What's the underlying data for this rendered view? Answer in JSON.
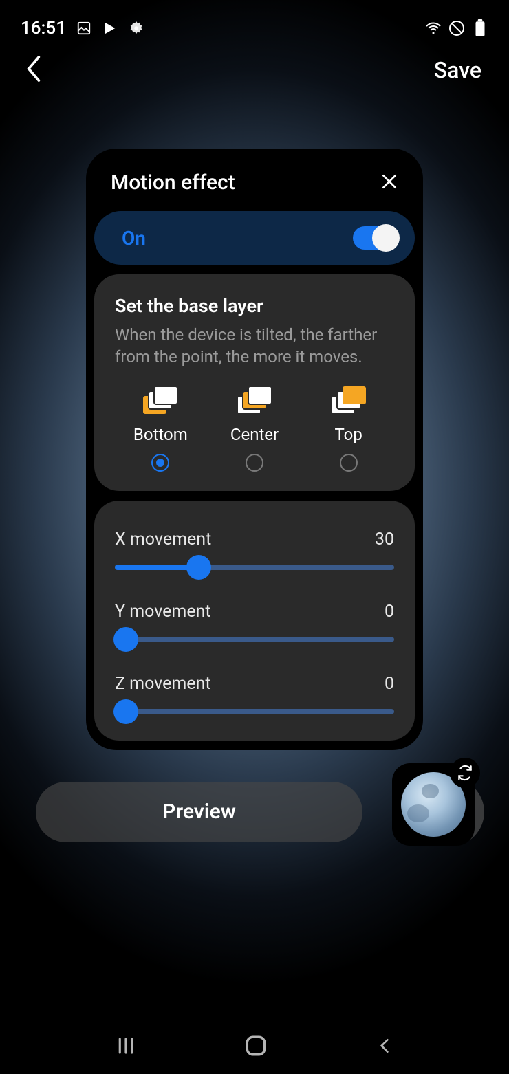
{
  "status": {
    "time": "16:51"
  },
  "header": {
    "save": "Save"
  },
  "panel": {
    "title": "Motion effect",
    "toggle_label": "On",
    "base_layer": {
      "title": "Set the base layer",
      "desc": "When the device is tilted, the farther from the point, the more it moves.",
      "options": [
        {
          "label": "Bottom",
          "selected": true
        },
        {
          "label": "Center",
          "selected": false
        },
        {
          "label": "Top",
          "selected": false
        }
      ]
    },
    "sliders": [
      {
        "label": "X movement",
        "value": "30",
        "pct": 30
      },
      {
        "label": "Y movement",
        "value": "0",
        "pct": 0
      },
      {
        "label": "Z movement",
        "value": "0",
        "pct": 0
      }
    ]
  },
  "bottom": {
    "preview": "Preview"
  }
}
